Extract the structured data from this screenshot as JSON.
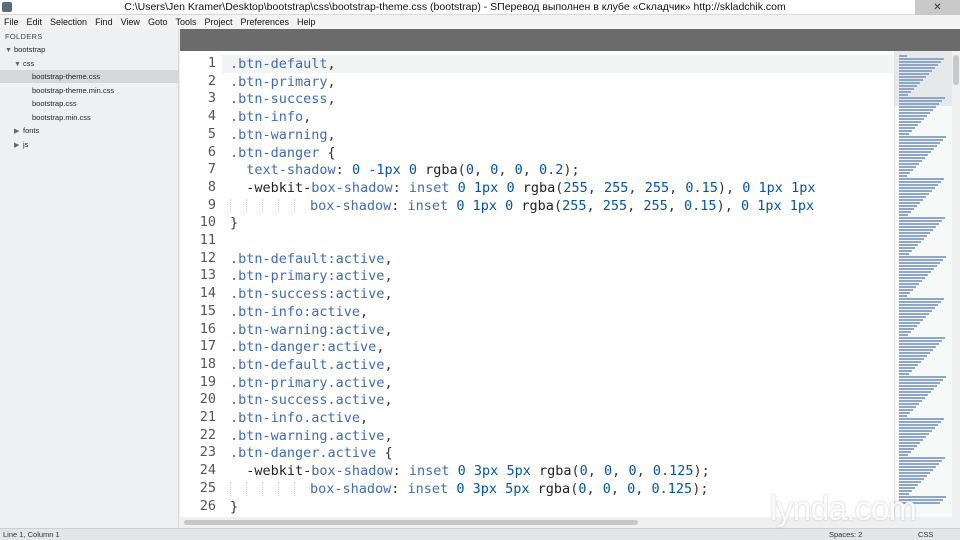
{
  "window": {
    "title": "C:\\Users\\Jen Kramer\\Desktop\\bootstrap\\css\\bootstrap-theme.css (bootstrap) - SПеревод выполнен в клубе «Складчик» http://skladchik.com",
    "close_glyph": "✕"
  },
  "menu": [
    "File",
    "Edit",
    "Selection",
    "Find",
    "View",
    "Goto",
    "Tools",
    "Project",
    "Preferences",
    "Help"
  ],
  "sidebar": {
    "header": "FOLDERS",
    "tree": [
      {
        "label": "bootstrap",
        "arrow": "▼",
        "depth": 0,
        "selected": false
      },
      {
        "label": "css",
        "arrow": "▼",
        "depth": 1,
        "selected": false
      },
      {
        "label": "bootstrap-theme.css",
        "arrow": "",
        "depth": 2,
        "selected": true
      },
      {
        "label": "bootstrap-theme.min.css",
        "arrow": "",
        "depth": 2,
        "selected": false
      },
      {
        "label": "bootstrap.css",
        "arrow": "",
        "depth": 2,
        "selected": false
      },
      {
        "label": "bootstrap.min.css",
        "arrow": "",
        "depth": 2,
        "selected": false
      },
      {
        "label": "fonts",
        "arrow": "▶",
        "depth": 1,
        "selected": false
      },
      {
        "label": "js",
        "arrow": "▶",
        "depth": 1,
        "selected": false
      }
    ]
  },
  "editor": {
    "lines": [
      {
        "n": "1",
        "t": [
          [
            ".btn-default",
            "sel"
          ],
          [
            ",",
            "punc"
          ]
        ]
      },
      {
        "n": "2",
        "t": [
          [
            ".btn-primary",
            "sel"
          ],
          [
            ",",
            "punc"
          ]
        ]
      },
      {
        "n": "3",
        "t": [
          [
            ".btn-success",
            "sel"
          ],
          [
            ",",
            "punc"
          ]
        ]
      },
      {
        "n": "4",
        "t": [
          [
            ".btn-info",
            "sel"
          ],
          [
            ",",
            "punc"
          ]
        ]
      },
      {
        "n": "5",
        "t": [
          [
            ".btn-warning",
            "sel"
          ],
          [
            ",",
            "punc"
          ]
        ]
      },
      {
        "n": "6",
        "t": [
          [
            ".btn-danger",
            "sel"
          ],
          [
            " {",
            "punc"
          ]
        ]
      },
      {
        "n": "7",
        "t": [
          [
            "  ",
            "punc"
          ],
          [
            "text-shadow",
            "prop"
          ],
          [
            ": ",
            "punc"
          ],
          [
            "0",
            "num"
          ],
          [
            " ",
            "punc"
          ],
          [
            "-1px",
            "num"
          ],
          [
            " ",
            "punc"
          ],
          [
            "0",
            "num"
          ],
          [
            " ",
            "punc"
          ],
          [
            "rgba",
            "fn"
          ],
          [
            "(",
            "punc"
          ],
          [
            "0",
            "num"
          ],
          [
            ", ",
            "punc"
          ],
          [
            "0",
            "num"
          ],
          [
            ", ",
            "punc"
          ],
          [
            "0",
            "num"
          ],
          [
            ", ",
            "punc"
          ],
          [
            "0.2",
            "num"
          ],
          [
            ");",
            "punc"
          ]
        ]
      },
      {
        "n": "8",
        "t": [
          [
            "  ",
            "punc"
          ],
          [
            "-webkit-",
            "fn"
          ],
          [
            "box-shadow",
            "prop"
          ],
          [
            ": ",
            "punc"
          ],
          [
            "inset",
            "kw"
          ],
          [
            " ",
            "punc"
          ],
          [
            "0",
            "num"
          ],
          [
            " ",
            "punc"
          ],
          [
            "1px",
            "num"
          ],
          [
            " ",
            "punc"
          ],
          [
            "0",
            "num"
          ],
          [
            " ",
            "punc"
          ],
          [
            "rgba",
            "fn"
          ],
          [
            "(",
            "punc"
          ],
          [
            "255",
            "num"
          ],
          [
            ", ",
            "punc"
          ],
          [
            "255",
            "num"
          ],
          [
            ", ",
            "punc"
          ],
          [
            "255",
            "num"
          ],
          [
            ", ",
            "punc"
          ],
          [
            "0.15",
            "num"
          ],
          [
            "), ",
            "punc"
          ],
          [
            "0",
            "num"
          ],
          [
            " ",
            "punc"
          ],
          [
            "1px",
            "num"
          ],
          [
            " ",
            "punc"
          ],
          [
            "1px",
            "num"
          ]
        ]
      },
      {
        "n": "9",
        "t": [
          [
            "          ",
            "guide"
          ],
          [
            "box-shadow",
            "prop"
          ],
          [
            ": ",
            "punc"
          ],
          [
            "inset",
            "kw"
          ],
          [
            " ",
            "punc"
          ],
          [
            "0",
            "num"
          ],
          [
            " ",
            "punc"
          ],
          [
            "1px",
            "num"
          ],
          [
            " ",
            "punc"
          ],
          [
            "0",
            "num"
          ],
          [
            " ",
            "punc"
          ],
          [
            "rgba",
            "fn"
          ],
          [
            "(",
            "punc"
          ],
          [
            "255",
            "num"
          ],
          [
            ", ",
            "punc"
          ],
          [
            "255",
            "num"
          ],
          [
            ", ",
            "punc"
          ],
          [
            "255",
            "num"
          ],
          [
            ", ",
            "punc"
          ],
          [
            "0.15",
            "num"
          ],
          [
            "), ",
            "punc"
          ],
          [
            "0",
            "num"
          ],
          [
            " ",
            "punc"
          ],
          [
            "1px",
            "num"
          ],
          [
            " ",
            "punc"
          ],
          [
            "1px",
            "num"
          ]
        ]
      },
      {
        "n": "10",
        "t": [
          [
            "}",
            "punc"
          ]
        ]
      },
      {
        "n": "11",
        "t": []
      },
      {
        "n": "12",
        "t": [
          [
            ".btn-default:active",
            "sel"
          ],
          [
            ",",
            "punc"
          ]
        ]
      },
      {
        "n": "13",
        "t": [
          [
            ".btn-primary:active",
            "sel"
          ],
          [
            ",",
            "punc"
          ]
        ]
      },
      {
        "n": "14",
        "t": [
          [
            ".btn-success:active",
            "sel"
          ],
          [
            ",",
            "punc"
          ]
        ]
      },
      {
        "n": "15",
        "t": [
          [
            ".btn-info:active",
            "sel"
          ],
          [
            ",",
            "punc"
          ]
        ]
      },
      {
        "n": "16",
        "t": [
          [
            ".btn-warning:active",
            "sel"
          ],
          [
            ",",
            "punc"
          ]
        ]
      },
      {
        "n": "17",
        "t": [
          [
            ".btn-danger:active",
            "sel"
          ],
          [
            ",",
            "punc"
          ]
        ]
      },
      {
        "n": "18",
        "t": [
          [
            ".btn-default.active",
            "sel"
          ],
          [
            ",",
            "punc"
          ]
        ]
      },
      {
        "n": "19",
        "t": [
          [
            ".btn-primary.active",
            "sel"
          ],
          [
            ",",
            "punc"
          ]
        ]
      },
      {
        "n": "20",
        "t": [
          [
            ".btn-success.active",
            "sel"
          ],
          [
            ",",
            "punc"
          ]
        ]
      },
      {
        "n": "21",
        "t": [
          [
            ".btn-info.active",
            "sel"
          ],
          [
            ",",
            "punc"
          ]
        ]
      },
      {
        "n": "22",
        "t": [
          [
            ".btn-warning.active",
            "sel"
          ],
          [
            ",",
            "punc"
          ]
        ]
      },
      {
        "n": "23",
        "t": [
          [
            ".btn-danger.active",
            "sel"
          ],
          [
            " {",
            "punc"
          ]
        ]
      },
      {
        "n": "24",
        "t": [
          [
            "  ",
            "punc"
          ],
          [
            "-webkit-",
            "fn"
          ],
          [
            "box-shadow",
            "prop"
          ],
          [
            ": ",
            "punc"
          ],
          [
            "inset",
            "kw"
          ],
          [
            " ",
            "punc"
          ],
          [
            "0",
            "num"
          ],
          [
            " ",
            "punc"
          ],
          [
            "3px",
            "num"
          ],
          [
            " ",
            "punc"
          ],
          [
            "5px",
            "num"
          ],
          [
            " ",
            "punc"
          ],
          [
            "rgba",
            "fn"
          ],
          [
            "(",
            "punc"
          ],
          [
            "0",
            "num"
          ],
          [
            ", ",
            "punc"
          ],
          [
            "0",
            "num"
          ],
          [
            ", ",
            "punc"
          ],
          [
            "0",
            "num"
          ],
          [
            ", ",
            "punc"
          ],
          [
            "0.125",
            "num"
          ],
          [
            ");",
            "punc"
          ]
        ]
      },
      {
        "n": "25",
        "t": [
          [
            "          ",
            "guide"
          ],
          [
            "box-shadow",
            "prop"
          ],
          [
            ": ",
            "punc"
          ],
          [
            "inset",
            "kw"
          ],
          [
            " ",
            "punc"
          ],
          [
            "0",
            "num"
          ],
          [
            " ",
            "punc"
          ],
          [
            "3px",
            "num"
          ],
          [
            " ",
            "punc"
          ],
          [
            "5px",
            "num"
          ],
          [
            " ",
            "punc"
          ],
          [
            "rgba",
            "fn"
          ],
          [
            "(",
            "punc"
          ],
          [
            "0",
            "num"
          ],
          [
            ", ",
            "punc"
          ],
          [
            "0",
            "num"
          ],
          [
            ", ",
            "punc"
          ],
          [
            "0",
            "num"
          ],
          [
            ", ",
            "punc"
          ],
          [
            "0.125",
            "num"
          ],
          [
            ");",
            "punc"
          ]
        ]
      },
      {
        "n": "26",
        "t": [
          [
            "}",
            "punc"
          ]
        ]
      }
    ]
  },
  "status": {
    "position": "Line 1, Column 1",
    "spaces": "Spaces: 2",
    "syntax": "CSS"
  },
  "watermark": "lynda.com",
  "colors": {
    "selector": "#3f6bb5",
    "number": "#0055aa",
    "tabbar": "#6b6b6b",
    "sidebar_bg": "#eef0f2"
  }
}
